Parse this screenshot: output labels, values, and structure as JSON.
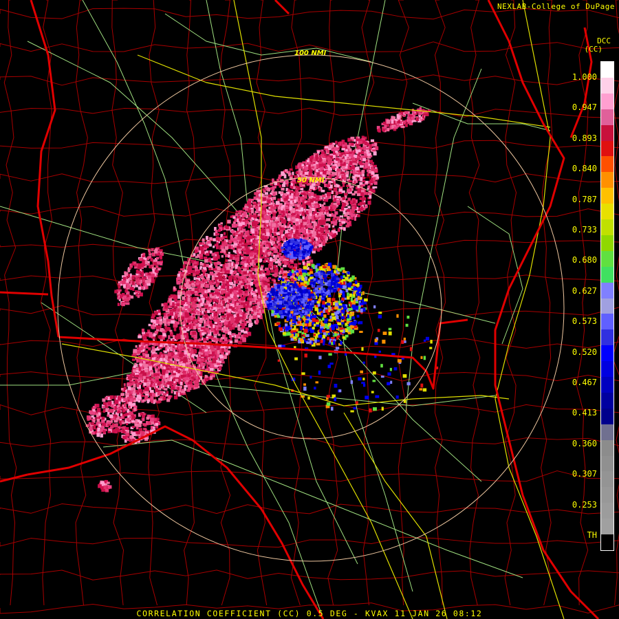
{
  "credit": "NEXLAB-College of DuPage",
  "product": {
    "code": "DCC",
    "unit": "(CC)",
    "footer": "CORRELATION COEFFICIENT (CC) 0.5 DEG - KVAX 11 JAN 26 08:12"
  },
  "range_rings": [
    {
      "label": "50 NMI"
    },
    {
      "label": "100 NMI"
    }
  ],
  "colorbar": {
    "ticks": [
      "1.000",
      "0.947",
      "0.893",
      "0.840",
      "0.787",
      "0.733",
      "0.680",
      "0.627",
      "0.573",
      "0.520",
      "0.467",
      "0.413",
      "0.360",
      "0.307",
      "0.253",
      "TH"
    ],
    "colors": [
      "#ffffff",
      "#ffd0e8",
      "#ff9fd0",
      "#e0609a",
      "#c8103c",
      "#e01010",
      "#ff5000",
      "#ff9000",
      "#ffc000",
      "#e8e000",
      "#c0e000",
      "#90d800",
      "#60e040",
      "#40e060",
      "#8080ff",
      "#a0a0e0",
      "#6060ff",
      "#3030e0",
      "#0000ff",
      "#0000e0",
      "#0000c0",
      "#0000a0",
      "#00008c",
      "#707090",
      "#8c8c8c",
      "#909090",
      "#949494",
      "#989898",
      "#9c9c9c",
      "#a0a0a0",
      "#000000"
    ]
  },
  "colors": {
    "state_borders": "#e00000",
    "counties": "#a80000",
    "highways": "#e0e000",
    "roads": "#a0e080",
    "rings": "#f0c8a0",
    "text": "#ffff00"
  }
}
